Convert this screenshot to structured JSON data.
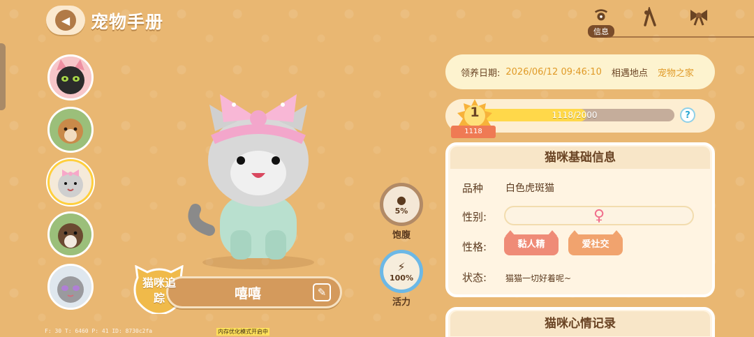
{
  "header": {
    "title": "宠物手册",
    "back_icon": "chevron-left-icon"
  },
  "top_tabs": [
    {
      "icon": "bell-collar-icon",
      "label": "信息",
      "active": true
    },
    {
      "icon": "pose-icon",
      "label": "",
      "active": false
    },
    {
      "icon": "bow-icon",
      "label": "",
      "active": false
    }
  ],
  "pets": [
    {
      "name": "black-cat-pink-hood"
    },
    {
      "name": "brown-cat-green-hood"
    },
    {
      "name": "grey-cat-pink-bow",
      "selected": true
    },
    {
      "name": "tabby-cat-green-hood"
    },
    {
      "name": "grey-cat-purple-eyes"
    }
  ],
  "cat": {
    "name": "嘻嘻",
    "track_label": "猫咪追踪"
  },
  "stats": {
    "hunger": {
      "value": "5%",
      "label": "饱腹",
      "fraction": 0.05
    },
    "energy": {
      "value": "100%",
      "label": "活力",
      "fraction": 1.0
    }
  },
  "adoption": {
    "date_label": "领养日期:",
    "date_value": "2026/06/12 09:46:10",
    "place_label": "相遇地点",
    "place_value": "宠物之家"
  },
  "level": {
    "level": "1",
    "badge": "1118",
    "progress_text": "1118/2000",
    "current": 1118,
    "max": 2000,
    "help": "?"
  },
  "basic_info": {
    "title": "猫咪基础信息",
    "breed_label": "品种",
    "breed_value": "白色虎斑猫",
    "gender_label": "性别:",
    "gender_value": "♀",
    "personality_label": "性格:",
    "traits": [
      "黏人精",
      "爱社交"
    ],
    "status_label": "状态:",
    "status_value": "猫猫一切好着呢~"
  },
  "mood": {
    "title": "猫咪心情记录"
  },
  "debug": {
    "fps": "F: 30    T: 6460    P: 41    ID: 8730c2fa",
    "memory": "内存优化模式开启中"
  },
  "colors": {
    "background": "#e9b772",
    "accent_yellow": "#ffd84a",
    "trait_1": "#ef8b77",
    "trait_2": "#f1a36e",
    "energy_ring": "#6cb8e6"
  }
}
